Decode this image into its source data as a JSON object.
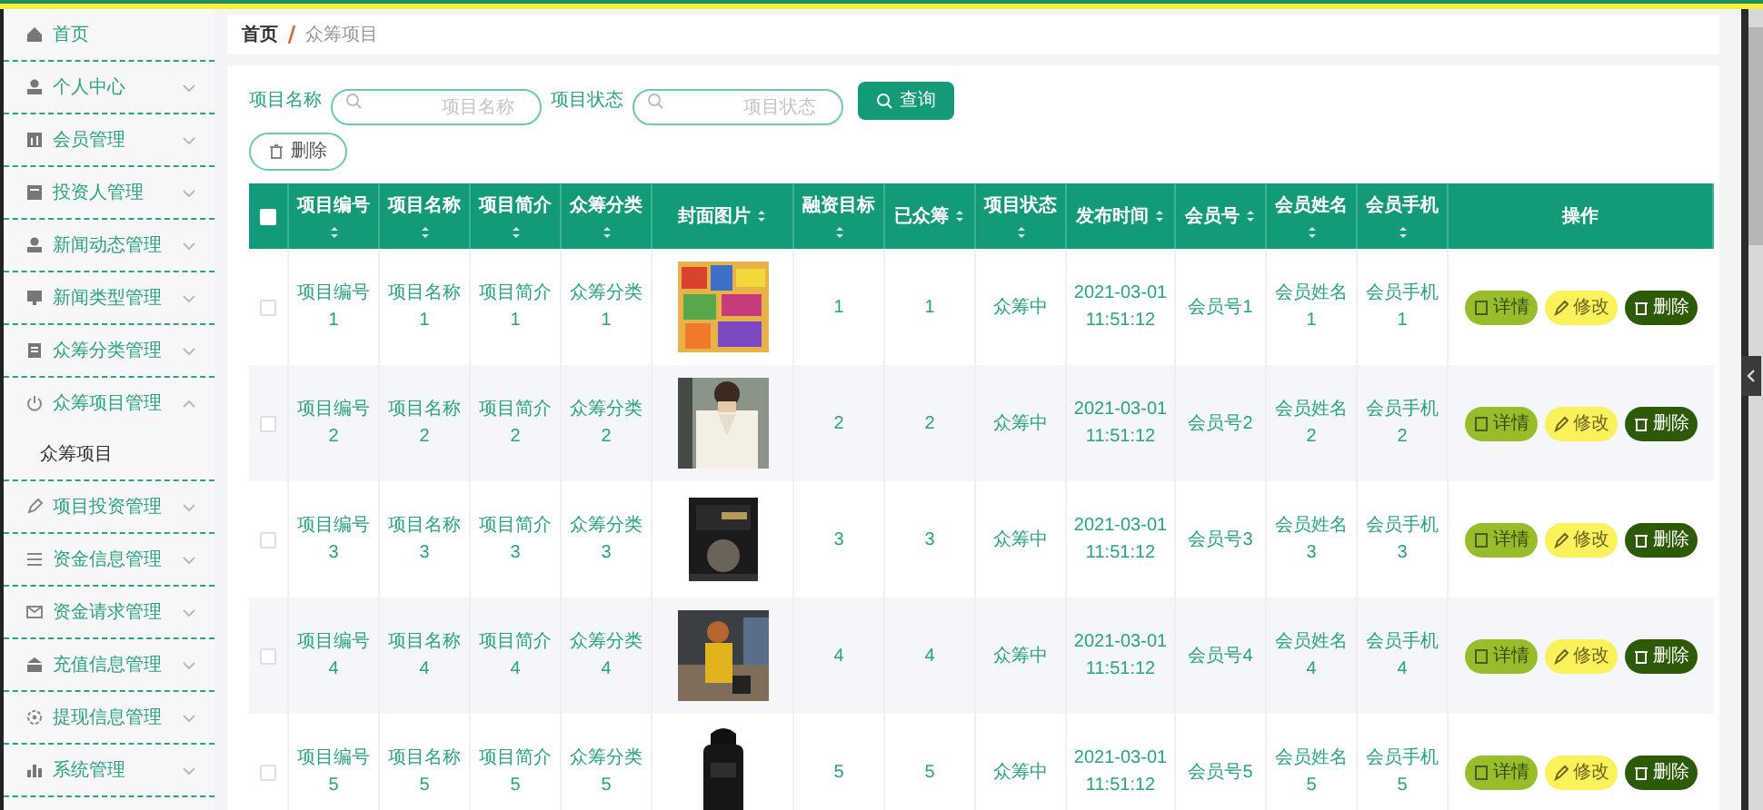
{
  "sidebar": {
    "items": [
      {
        "label": "首页",
        "kind": "link"
      },
      {
        "label": "个人中心",
        "kind": "menu",
        "expanded": false
      },
      {
        "label": "会员管理",
        "kind": "menu",
        "expanded": false
      },
      {
        "label": "投资人管理",
        "kind": "menu",
        "expanded": false
      },
      {
        "label": "新闻动态管理",
        "kind": "menu",
        "expanded": false
      },
      {
        "label": "新闻类型管理",
        "kind": "menu",
        "expanded": false
      },
      {
        "label": "众筹分类管理",
        "kind": "menu",
        "expanded": false
      },
      {
        "label": "众筹项目管理",
        "kind": "menu",
        "expanded": true,
        "children": [
          {
            "label": "众筹项目"
          }
        ]
      },
      {
        "label": "项目投资管理",
        "kind": "menu",
        "expanded": false
      },
      {
        "label": "资金信息管理",
        "kind": "menu",
        "expanded": false
      },
      {
        "label": "资金请求管理",
        "kind": "menu",
        "expanded": false
      },
      {
        "label": "充值信息管理",
        "kind": "menu",
        "expanded": false
      },
      {
        "label": "提现信息管理",
        "kind": "menu",
        "expanded": false
      },
      {
        "label": "系统管理",
        "kind": "menu",
        "expanded": false
      }
    ]
  },
  "breadcrumb": [
    "首页",
    "众筹项目"
  ],
  "search": {
    "fields": [
      {
        "label": "项目名称",
        "placeholder": "项目名称"
      },
      {
        "label": "项目状态",
        "placeholder": "项目状态"
      }
    ],
    "query_button": "查询",
    "delete_button": "删除"
  },
  "table": {
    "header_checkbox": {
      "checked": false
    },
    "columns": [
      {
        "label": "项目编号",
        "sortable": true
      },
      {
        "label": "项目名称",
        "sortable": true
      },
      {
        "label": "项目简介",
        "sortable": true
      },
      {
        "label": "众筹分类",
        "sortable": true
      },
      {
        "label": "封面图片",
        "sortable": true
      },
      {
        "label": "融资目标",
        "sortable": true
      },
      {
        "label": "已众筹",
        "sortable": true
      },
      {
        "label": "项目状态",
        "sortable": true
      },
      {
        "label": "发布时间",
        "sortable": true
      },
      {
        "label": "会员号",
        "sortable": true
      },
      {
        "label": "会员姓名",
        "sortable": true
      },
      {
        "label": "会员手机",
        "sortable": true
      },
      {
        "label": "操作",
        "sortable": false
      }
    ],
    "rows": [
      {
        "checked": false,
        "cells": [
          "项目编号1",
          "项目名称1",
          "项目简介1",
          "众筹分类1",
          {
            "kind": "picture"
          },
          "1",
          "1",
          "众筹中",
          "2021-03-01 11:51:12",
          "会员号1",
          "会员姓名1",
          "会员手机1"
        ],
        "actions": [
          {
            "label": "详情",
            "kind": "detail"
          },
          {
            "label": "修改",
            "kind": "edit"
          },
          {
            "label": "删除",
            "kind": "delete"
          }
        ]
      },
      {
        "checked": false,
        "cells": [
          "项目编号2",
          "项目名称2",
          "项目简介2",
          "众筹分类2",
          {
            "kind": "picture"
          },
          "2",
          "2",
          "众筹中",
          "2021-03-01 11:51:12",
          "会员号2",
          "会员姓名2",
          "会员手机2"
        ],
        "actions": [
          {
            "label": "详情",
            "kind": "detail"
          },
          {
            "label": "修改",
            "kind": "edit"
          },
          {
            "label": "删除",
            "kind": "delete"
          }
        ]
      },
      {
        "checked": false,
        "cells": [
          "项目编号3",
          "项目名称3",
          "项目简介3",
          "众筹分类3",
          {
            "kind": "picture"
          },
          "3",
          "3",
          "众筹中",
          "2021-03-01 11:51:12",
          "会员号3",
          "会员姓名3",
          "会员手机3"
        ],
        "actions": [
          {
            "label": "详情",
            "kind": "detail"
          },
          {
            "label": "修改",
            "kind": "edit"
          },
          {
            "label": "删除",
            "kind": "delete"
          }
        ]
      },
      {
        "checked": false,
        "cells": [
          "项目编号4",
          "项目名称4",
          "项目简介4",
          "众筹分类4",
          {
            "kind": "picture"
          },
          "4",
          "4",
          "众筹中",
          "2021-03-01 11:51:12",
          "会员号4",
          "会员姓名4",
          "会员手机4"
        ],
        "actions": [
          {
            "label": "详情",
            "kind": "detail"
          },
          {
            "label": "修改",
            "kind": "edit"
          },
          {
            "label": "删除",
            "kind": "delete"
          }
        ]
      },
      {
        "checked": false,
        "cells": [
          "项目编号5",
          "项目名称5",
          "项目简介5",
          "众筹分类5",
          {
            "kind": "picture"
          },
          "5",
          "5",
          "众筹中",
          "2021-03-01 11:51:12",
          "会员号5",
          "会员姓名5",
          "会员手机5"
        ],
        "actions": [
          {
            "label": "详情",
            "kind": "detail"
          },
          {
            "label": "修改",
            "kind": "edit"
          },
          {
            "label": "删除",
            "kind": "delete"
          }
        ]
      }
    ]
  }
}
